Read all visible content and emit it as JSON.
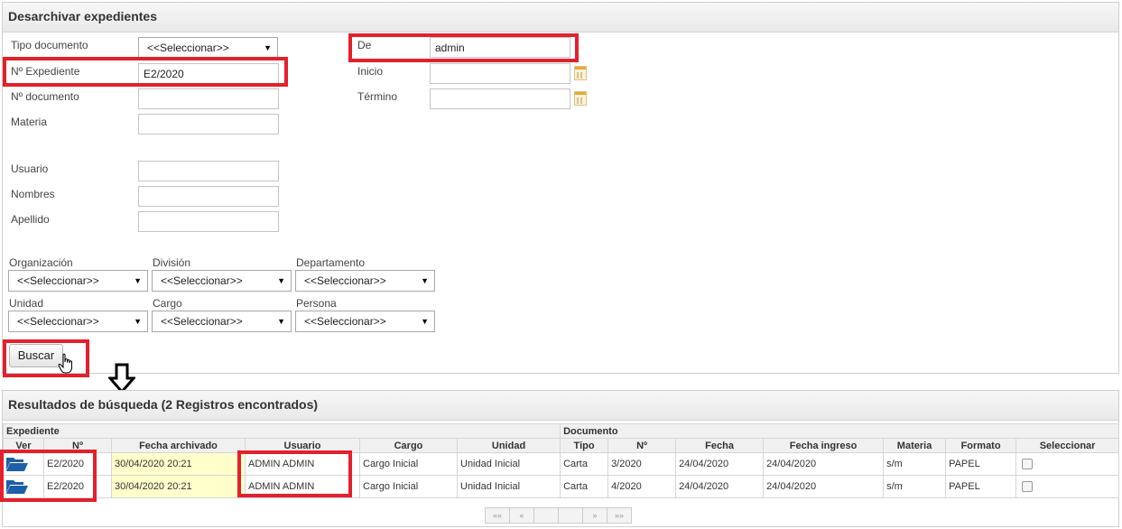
{
  "search_panel": {
    "title": "Desarchivar expedientes",
    "fields": {
      "tipo_documento": {
        "label": "Tipo documento",
        "value": "<<Seleccionar>>"
      },
      "n_expediente": {
        "label": "Nº Expediente",
        "value": "E2/2020"
      },
      "n_documento": {
        "label": "Nº documento",
        "value": ""
      },
      "materia": {
        "label": "Materia",
        "value": ""
      },
      "usuario": {
        "label": "Usuario",
        "value": ""
      },
      "nombres": {
        "label": "Nombres",
        "value": ""
      },
      "apellido": {
        "label": "Apellido",
        "value": ""
      },
      "de": {
        "label": "De",
        "value": "admin"
      },
      "inicio": {
        "label": "Inicio",
        "value": ""
      },
      "termino": {
        "label": "Término",
        "value": ""
      }
    },
    "selects": {
      "organizacion": {
        "label": "Organización",
        "value": "<<Seleccionar>>"
      },
      "division": {
        "label": "División",
        "value": "<<Seleccionar>>"
      },
      "departamento": {
        "label": "Departamento",
        "value": "<<Seleccionar>>"
      },
      "unidad": {
        "label": "Unidad",
        "value": "<<Seleccionar>>"
      },
      "cargo": {
        "label": "Cargo",
        "value": "<<Seleccionar>>"
      },
      "persona": {
        "label": "Persona",
        "value": "<<Seleccionar>>"
      }
    },
    "search_button": "Buscar"
  },
  "results_panel": {
    "title": "Resultados de búsqueda (2 Registros encontrados)",
    "group_headers": {
      "expediente": "Expediente",
      "documento": "Documento"
    },
    "columns": [
      "Ver",
      "Nº",
      "Fecha archivado",
      "Usuario",
      "Cargo",
      "Unidad",
      "Tipo",
      "Nº",
      "Fecha",
      "Fecha ingreso",
      "Materia",
      "Formato",
      "Seleccionar"
    ],
    "rows": [
      {
        "n": "E2/2020",
        "fecha_archivado": "30/04/2020 20:21",
        "usuario": "ADMIN ADMIN",
        "cargo": "Cargo Inicial",
        "unidad": "Unidad Inicial",
        "tipo": "Carta",
        "doc_n": "3/2020",
        "fecha": "24/04/2020",
        "fecha_ingreso": "24/04/2020",
        "materia": "s/m",
        "formato": "PAPEL"
      },
      {
        "n": "E2/2020",
        "fecha_archivado": "30/04/2020 20:21",
        "usuario": "ADMIN ADMIN",
        "cargo": "Cargo Inicial",
        "unidad": "Unidad Inicial",
        "tipo": "Carta",
        "doc_n": "4/2020",
        "fecha": "24/04/2020",
        "fecha_ingreso": "24/04/2020",
        "materia": "s/m",
        "formato": "PAPEL"
      }
    ],
    "pager": {
      "first": "««",
      "prev": "«",
      "next": "»",
      "last": "»»"
    }
  },
  "icons": {
    "folder": "folder-open-icon",
    "calendar": "calendar-icon",
    "arrow": "arrow-down-icon",
    "cursor": "hand-cursor-icon"
  },
  "colors": {
    "highlight": "#e3202b",
    "folder": "#1f5fa8",
    "date_cell": "#ffffcc"
  }
}
